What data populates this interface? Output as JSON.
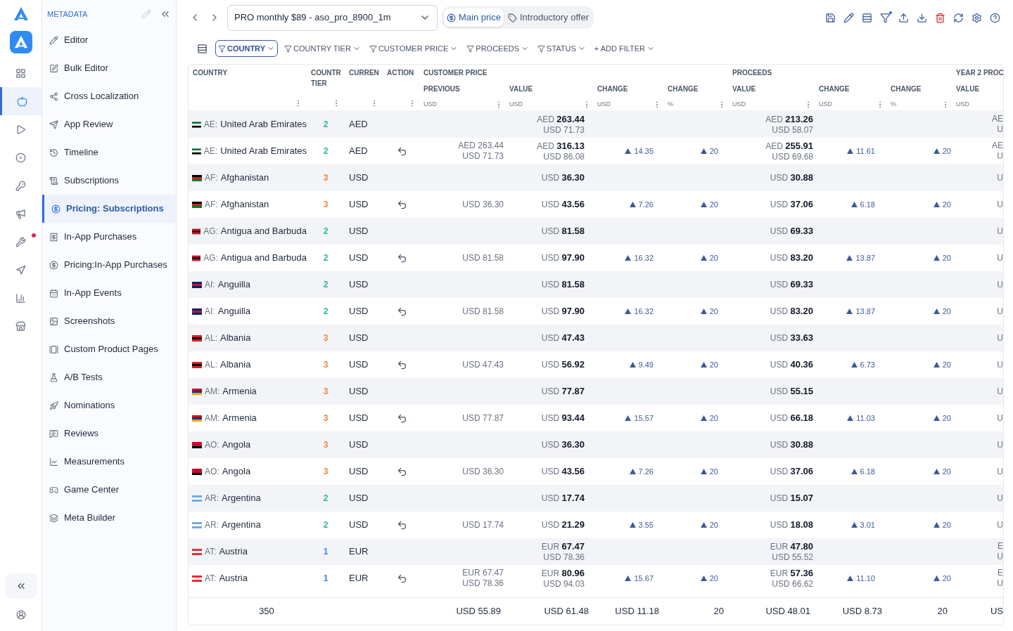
{
  "rail": [
    {
      "selected": false,
      "dot": false
    },
    {
      "selected": true,
      "dot": false
    },
    {
      "selected": false,
      "dot": false
    },
    {
      "selected": false,
      "dot": false
    },
    {
      "selected": false,
      "dot": false
    },
    {
      "selected": false,
      "dot": false
    },
    {
      "selected": false,
      "dot": true
    },
    {
      "selected": false,
      "dot": false
    },
    {
      "selected": false,
      "dot": false
    },
    {
      "selected": false,
      "dot": false
    }
  ],
  "sidebar": {
    "title": "METADATA",
    "items": [
      {
        "label": "Editor",
        "selected": false
      },
      {
        "label": "Bulk Editor",
        "selected": false
      },
      {
        "label": "Cross Localization",
        "selected": false
      },
      {
        "label": "App Review",
        "selected": false
      },
      {
        "label": "Timeline",
        "selected": false
      },
      {
        "label": "Subscriptions",
        "selected": false
      },
      {
        "label": "Pricing: Subscriptions",
        "selected": true
      },
      {
        "label": "In-App Purchases",
        "selected": false
      },
      {
        "label": "Pricing:In-App Purchases",
        "selected": false
      },
      {
        "label": "In-App Events",
        "selected": false
      },
      {
        "label": "Screenshots",
        "selected": false
      },
      {
        "label": "Custom Product Pages",
        "selected": false
      },
      {
        "label": "A/B Tests",
        "selected": false
      },
      {
        "label": "Nominations",
        "selected": false
      },
      {
        "label": "Reviews",
        "selected": false
      },
      {
        "label": "Measurements",
        "selected": false
      },
      {
        "label": "Game Center",
        "selected": false
      },
      {
        "label": "Meta Builder",
        "selected": false
      }
    ]
  },
  "product_select": {
    "value": "PRO monthly $89 - aso_pro_8900_1m"
  },
  "tabs": [
    {
      "label": "Main price",
      "selected": true
    },
    {
      "label": "Introductory offer",
      "selected": false
    }
  ],
  "toolbar": {
    "filter_dot": true
  },
  "filters": [
    {
      "label": "COUNTRY",
      "selected": true
    },
    {
      "label": "COUNTRY TIER",
      "selected": false
    },
    {
      "label": "CUSTOMER PRICE",
      "selected": false
    },
    {
      "label": "PROCEEDS",
      "selected": false
    },
    {
      "label": "STATUS",
      "selected": false
    }
  ],
  "add_filter": "+ ADD FILTER",
  "table": {
    "group_headers": [
      {
        "lines": [
          "COUNTRY"
        ]
      },
      {
        "lines": [
          "COUNTR",
          "TIER"
        ]
      },
      {
        "lines": [
          "CURREN"
        ]
      },
      {
        "lines": [
          "ACTION"
        ]
      },
      {
        "lines": [
          "CUSTOMER PRICE"
        ]
      },
      {
        "lines": [
          "PROCEEDS"
        ]
      },
      {
        "lines": [
          "YEAR 2 PROC"
        ]
      }
    ],
    "sub_headers": [
      {
        "label": "PREVIOUS",
        "unit": "USD"
      },
      {
        "label": "VALUE",
        "unit": "USD"
      },
      {
        "label": "CHANGE",
        "unit": "USD"
      },
      {
        "label": "CHANGE",
        "unit": "%"
      },
      {
        "label": "VALUE",
        "unit": "USD"
      },
      {
        "label": "CHANGE",
        "unit": "USD"
      },
      {
        "label": "CHANGE",
        "unit": "%"
      },
      {
        "label": "VALUE",
        "unit": "USD"
      }
    ],
    "rows": [
      {
        "flag": [
          {
            "color": "#00732f"
          },
          {
            "color": "#ffffff"
          },
          {
            "color": "#000000"
          }
        ],
        "code": "AE:",
        "country": "United Arab Emirates",
        "tier": {
          "text": "2",
          "color": "#2bb5a0"
        },
        "currency": "AED",
        "revert": false,
        "value": [
          "AED **263.44**",
          "USD 71.73"
        ],
        "proceeds": [
          "AED **213.26**",
          "USD 58.07"
        ],
        "year2": [
          "AE",
          "U"
        ]
      },
      {
        "flag": [
          {
            "color": "#00732f"
          },
          {
            "color": "#ffffff"
          },
          {
            "color": "#000000"
          }
        ],
        "code": "AE:",
        "country": "United Arab Emirates",
        "tier": {
          "text": "2",
          "color": "#2bb5a0"
        },
        "currency": "AED",
        "revert": true,
        "previous": [
          "AED 263.44",
          "USD 71.73"
        ],
        "value": [
          "AED **316.13**",
          "USD 86.08"
        ],
        "change": "14.35",
        "change_pct": "20",
        "proceeds": [
          "AED **255.91**",
          "USD 69.68"
        ],
        "proceeds_change": "11.61",
        "proceeds_change_pct": "20",
        "year2": [
          "AE",
          "U"
        ]
      },
      {
        "flag": [
          {
            "color": "#000000"
          },
          {
            "color": "#d32011"
          },
          {
            "color": "#007a36"
          }
        ],
        "code": "AF:",
        "country": "Afghanistan",
        "tier": {
          "text": "3",
          "color": "#e8883a"
        },
        "currency": "USD",
        "revert": false,
        "value": [
          "USD **36.30**"
        ],
        "proceeds": [
          "USD **30.88**"
        ],
        "year2": [
          "U"
        ]
      },
      {
        "flag": [
          {
            "color": "#000000"
          },
          {
            "color": "#d32011"
          },
          {
            "color": "#007a36"
          }
        ],
        "code": "AF:",
        "country": "Afghanistan",
        "tier": {
          "text": "3",
          "color": "#e8883a"
        },
        "currency": "USD",
        "revert": true,
        "previous": [
          "USD 36.30"
        ],
        "value": [
          "USD **43.56**"
        ],
        "change": "7.26",
        "change_pct": "20",
        "proceeds": [
          "USD **37.06**"
        ],
        "proceeds_change": "6.18",
        "proceeds_change_pct": "20",
        "year2": [
          "U"
        ]
      },
      {
        "flag": [
          {
            "color": "#ce1126"
          },
          {
            "color": "#000000"
          },
          {
            "color": "#ce1126"
          }
        ],
        "code": "AG:",
        "country": "Antigua and Barbuda",
        "tier": {
          "text": "2",
          "color": "#2bb5a0"
        },
        "currency": "USD",
        "revert": false,
        "value": [
          "USD **81.58**"
        ],
        "proceeds": [
          "USD **69.33**"
        ],
        "year2": [
          "U"
        ]
      },
      {
        "flag": [
          {
            "color": "#ce1126"
          },
          {
            "color": "#000000"
          },
          {
            "color": "#ce1126"
          }
        ],
        "code": "AG:",
        "country": "Antigua and Barbuda",
        "tier": {
          "text": "2",
          "color": "#2bb5a0"
        },
        "currency": "USD",
        "revert": true,
        "previous": [
          "USD 81.58"
        ],
        "value": [
          "USD **97.90**"
        ],
        "change": "16.32",
        "change_pct": "20",
        "proceeds": [
          "USD **83.20**"
        ],
        "proceeds_change": "13.87",
        "proceeds_change_pct": "20",
        "year2": [
          "U"
        ]
      },
      {
        "flag": [
          {
            "color": "#012169"
          },
          {
            "color": "#c8102e"
          },
          {
            "color": "#012169"
          }
        ],
        "code": "AI:",
        "country": "Anguilla",
        "tier": {
          "text": "2",
          "color": "#2bb5a0"
        },
        "currency": "USD",
        "revert": false,
        "value": [
          "USD **81.58**"
        ],
        "proceeds": [
          "USD **69.33**"
        ],
        "year2": [
          "U"
        ]
      },
      {
        "flag": [
          {
            "color": "#012169"
          },
          {
            "color": "#c8102e"
          },
          {
            "color": "#012169"
          }
        ],
        "code": "AI:",
        "country": "Anguilla",
        "tier": {
          "text": "2",
          "color": "#2bb5a0"
        },
        "currency": "USD",
        "revert": true,
        "previous": [
          "USD 81.58"
        ],
        "value": [
          "USD **97.90**"
        ],
        "change": "16.32",
        "change_pct": "20",
        "proceeds": [
          "USD **83.20**"
        ],
        "proceeds_change": "13.87",
        "proceeds_change_pct": "20",
        "year2": [
          "U"
        ]
      },
      {
        "flag": [
          {
            "color": "#e41e20"
          },
          {
            "color": "#000000"
          },
          {
            "color": "#e41e20"
          }
        ],
        "code": "AL:",
        "country": "Albania",
        "tier": {
          "text": "3",
          "color": "#e8883a"
        },
        "currency": "USD",
        "revert": false,
        "value": [
          "USD **47.43**"
        ],
        "proceeds": [
          "USD **33.63**"
        ],
        "year2": [
          "U"
        ]
      },
      {
        "flag": [
          {
            "color": "#e41e20"
          },
          {
            "color": "#000000"
          },
          {
            "color": "#e41e20"
          }
        ],
        "code": "AL:",
        "country": "Albania",
        "tier": {
          "text": "3",
          "color": "#e8883a"
        },
        "currency": "USD",
        "revert": true,
        "previous": [
          "USD 47.43"
        ],
        "value": [
          "USD **56.92**"
        ],
        "change": "9.49",
        "change_pct": "20",
        "proceeds": [
          "USD **40.36**"
        ],
        "proceeds_change": "6.73",
        "proceeds_change_pct": "20",
        "year2": [
          "U"
        ]
      },
      {
        "flag": [
          {
            "color": "#d90012"
          },
          {
            "color": "#0033a0"
          },
          {
            "color": "#f2a800"
          }
        ],
        "code": "AM:",
        "country": "Armenia",
        "tier": {
          "text": "3",
          "color": "#e8883a"
        },
        "currency": "USD",
        "revert": false,
        "value": [
          "USD **77.87**"
        ],
        "proceeds": [
          "USD **55.15**"
        ],
        "year2": [
          "U"
        ]
      },
      {
        "flag": [
          {
            "color": "#d90012"
          },
          {
            "color": "#0033a0"
          },
          {
            "color": "#f2a800"
          }
        ],
        "code": "AM:",
        "country": "Armenia",
        "tier": {
          "text": "3",
          "color": "#e8883a"
        },
        "currency": "USD",
        "revert": true,
        "previous": [
          "USD 77.87"
        ],
        "value": [
          "USD **93.44**"
        ],
        "change": "15.57",
        "change_pct": "20",
        "proceeds": [
          "USD **66.18**"
        ],
        "proceeds_change": "11.03",
        "proceeds_change_pct": "20",
        "year2": [
          "U"
        ]
      },
      {
        "flag": [
          {
            "color": "#cc092f"
          },
          {
            "color": "#cc092f"
          },
          {
            "color": "#000000"
          }
        ],
        "code": "AO:",
        "country": "Angola",
        "tier": {
          "text": "3",
          "color": "#e8883a"
        },
        "currency": "USD",
        "revert": false,
        "value": [
          "USD **36.30**"
        ],
        "proceeds": [
          "USD **30.88**"
        ],
        "year2": [
          "U"
        ]
      },
      {
        "flag": [
          {
            "color": "#cc092f"
          },
          {
            "color": "#cc092f"
          },
          {
            "color": "#000000"
          }
        ],
        "code": "AO:",
        "country": "Angola",
        "tier": {
          "text": "3",
          "color": "#e8883a"
        },
        "currency": "USD",
        "revert": true,
        "previous": [
          "USD 36.30"
        ],
        "value": [
          "USD **43.56**"
        ],
        "change": "7.26",
        "change_pct": "20",
        "proceeds": [
          "USD **37.06**"
        ],
        "proceeds_change": "6.18",
        "proceeds_change_pct": "20",
        "year2": [
          "U"
        ]
      },
      {
        "flag": [
          {
            "color": "#74acdf"
          },
          {
            "color": "#ffffff"
          },
          {
            "color": "#74acdf"
          }
        ],
        "code": "AR:",
        "country": "Argentina",
        "tier": {
          "text": "2",
          "color": "#2bb5a0"
        },
        "currency": "USD",
        "revert": false,
        "value": [
          "USD **17.74**"
        ],
        "proceeds": [
          "USD **15.07**"
        ],
        "year2": [
          "U"
        ]
      },
      {
        "flag": [
          {
            "color": "#74acdf"
          },
          {
            "color": "#ffffff"
          },
          {
            "color": "#74acdf"
          }
        ],
        "code": "AR:",
        "country": "Argentina",
        "tier": {
          "text": "2",
          "color": "#2bb5a0"
        },
        "currency": "USD",
        "revert": true,
        "previous": [
          "USD 17.74"
        ],
        "value": [
          "USD **21.29**"
        ],
        "change": "3.55",
        "change_pct": "20",
        "proceeds": [
          "USD **18.08**"
        ],
        "proceeds_change": "3.01",
        "proceeds_change_pct": "20",
        "year2": [
          "U"
        ]
      },
      {
        "flag": [
          {
            "color": "#ed2939"
          },
          {
            "color": "#ffffff"
          },
          {
            "color": "#ed2939"
          }
        ],
        "code": "AT:",
        "country": "Austria",
        "tier": {
          "text": "1",
          "color": "#3b82f6"
        },
        "currency": "EUR",
        "revert": false,
        "value": [
          "EUR **67.47**",
          "USD 78.36"
        ],
        "proceeds": [
          "EUR **47.80**",
          "USD 55.52"
        ],
        "year2": [
          "E",
          "U"
        ]
      },
      {
        "flag": [
          {
            "color": "#ed2939"
          },
          {
            "color": "#ffffff"
          },
          {
            "color": "#ed2939"
          }
        ],
        "code": "AT:",
        "country": "Austria",
        "tier": {
          "text": "1",
          "color": "#3b82f6"
        },
        "currency": "EUR",
        "revert": true,
        "previous": [
          "EUR 67.47",
          "USD 78.36"
        ],
        "value": [
          "EUR **80.96**",
          "USD 94.03"
        ],
        "change": "15.67",
        "change_pct": "20",
        "proceeds": [
          "EUR **57.36**",
          "USD 66.62"
        ],
        "proceeds_change": "11.10",
        "proceeds_change_pct": "20",
        "year2": [
          "E",
          "U"
        ]
      }
    ],
    "footer": {
      "count": "350",
      "previous": "USD 55.89",
      "value": "USD 61.48",
      "change": "USD 11.18",
      "change_pct": "20",
      "proceeds": "USD 48.01",
      "proceeds_change": "USD 8.73",
      "proceeds_change_pct": "20",
      "year2": "US"
    }
  }
}
